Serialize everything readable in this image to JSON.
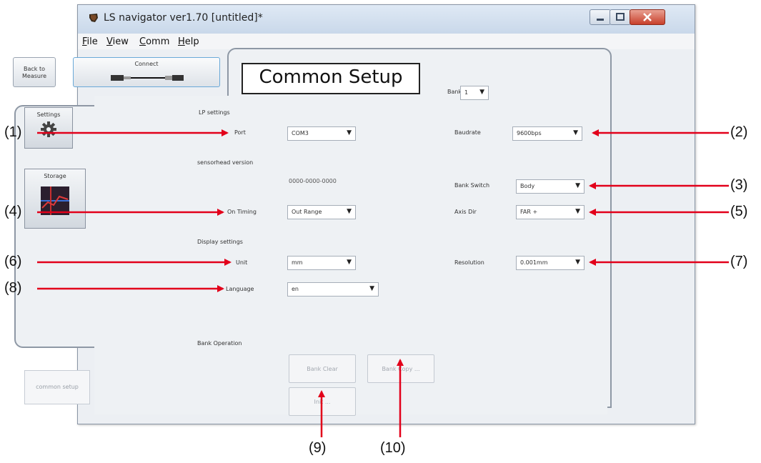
{
  "window": {
    "title": "LS navigator ver1.70 [untitled]*"
  },
  "menu": {
    "items": [
      {
        "key": "F",
        "rest": "ile"
      },
      {
        "key": "V",
        "rest": "iew"
      },
      {
        "key": "C",
        "rest": "omm"
      },
      {
        "key": "H",
        "rest": "elp"
      }
    ]
  },
  "toolbar": {
    "back_label_line1": "Back to",
    "back_label_line2": "Measure",
    "connect_label": "Connect"
  },
  "header": {
    "page_title": "Common Setup",
    "bank_label": "Bank",
    "bank_value": "1"
  },
  "sidebar": {
    "settings_label": "Settings",
    "storage_label": "Storage",
    "common_setup_label": "common setup"
  },
  "form": {
    "lp_settings_heading": "LP settings",
    "port_label": "Port",
    "port_value": "COM3",
    "baudrate_label": "Baudrate",
    "baudrate_value": "9600bps",
    "sensorhead_version_label": "sensorhead version",
    "sensorhead_version_value": "0000-0000-0000",
    "bank_switch_label": "Bank Switch",
    "bank_switch_value": "Body",
    "on_timing_label": "On Timing",
    "on_timing_value": "Out Range",
    "axis_dir_label": "Axis Dir",
    "axis_dir_value": "FAR +",
    "display_settings_heading": "Display settings",
    "unit_label": "Unit",
    "unit_value": "mm",
    "resolution_label": "Resolution",
    "resolution_value": "0.001mm",
    "language_label": "Language",
    "language_value": "en",
    "bank_operation_heading": "Bank Operation",
    "bank_clear_label": "Bank Clear",
    "bank_copy_label": "Bank Copy ...",
    "bank_init_label": "Init ..."
  },
  "annotations": {
    "c1": "(1)",
    "c2": "(2)",
    "c3": "(3)",
    "c4": "(4)",
    "c5": "(5)",
    "c6": "(6)",
    "c7": "(7)",
    "c8": "(8)",
    "c9": "(9)",
    "c10": "(10)"
  },
  "colors": {
    "arrow": "#e2001a",
    "window_frame": "#8a96a6",
    "connect_accent": "#6aa9d8"
  }
}
